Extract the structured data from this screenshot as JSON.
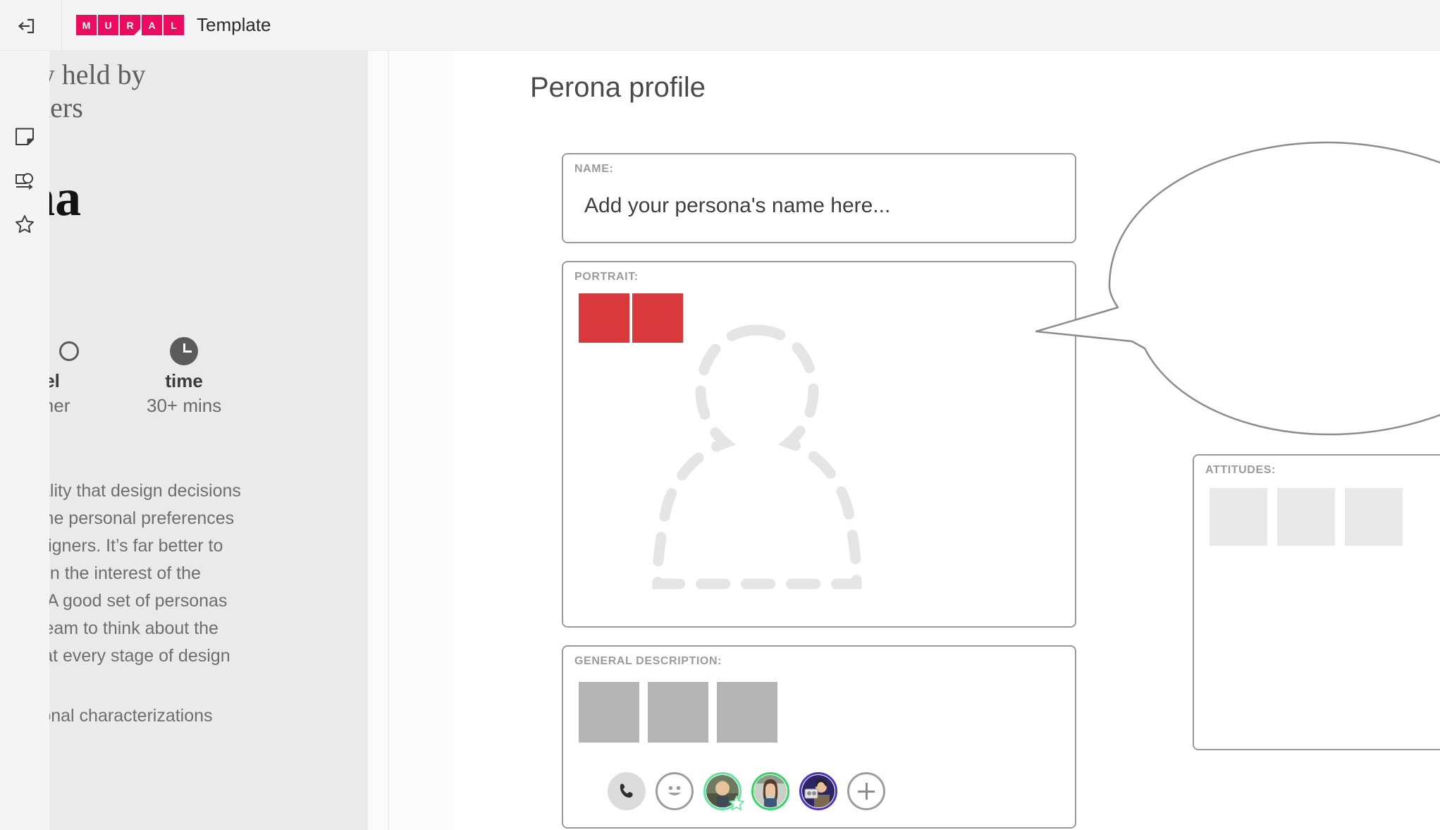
{
  "topbar": {
    "exit_icon": "exit-icon",
    "logo_letters": [
      "M",
      "U",
      "R",
      "A",
      "L"
    ],
    "logo_color": "#ec0b5f",
    "title": "Template"
  },
  "sidebar": {
    "items": [
      {
        "icon": "sticky-note-icon",
        "name": "sticky-note"
      },
      {
        "icon": "shapes-arrow-icon",
        "name": "shapes-and-connectors"
      },
      {
        "icon": "star-icon",
        "name": "favorites"
      }
    ]
  },
  "info_panel": {
    "subhead": "cally held by\nholders",
    "title": "ona\nle",
    "level": {
      "label": "level",
      "value": "eginner",
      "dots_total": 3,
      "dots_filled": 1
    },
    "time": {
      "label": "time",
      "value": "30+ mins",
      "icon": "clock-icon"
    },
    "body": "ue reality that design decisions\nd on the personal preferences\nof designers. It’s far better to\nsions in the interest of the\nrving. A good set of personas\nyour team to think about the\ndeas at every stage of design",
    "body_2": "e fictional characterizations"
  },
  "board": {
    "title": "Perona profile",
    "fields": {
      "name": {
        "label": "NAME:",
        "placeholder": "Add your persona's name here..."
      },
      "portrait": {
        "label": "PORTRAIT:",
        "swatch_color": "#d9383c",
        "swatch_count": 2,
        "placeholder_icon": "person-silhouette-icon"
      },
      "general_description": {
        "label": "GENERAL DESCRIPTION:",
        "swatch_color": "#b4b4b4",
        "swatch_count": 3
      },
      "attitudes": {
        "label": "ATTITUDES:",
        "swatch_color": "#e9e9e9",
        "swatch_count": 3
      }
    },
    "speech_bubble": {
      "name": "speech-bubble-shape",
      "fill": "#ffffff",
      "stroke": "#8c8c8c"
    }
  },
  "collab_toolbar": {
    "phone_icon": "phone-icon",
    "reaction_icon": "smiley-icon",
    "add_label": "+",
    "avatars": [
      {
        "name": "collaborator-1",
        "ring": "#5ce89a",
        "badge": "star-badge-icon"
      },
      {
        "name": "collaborator-2",
        "ring": "#2fd95f",
        "badge": null
      },
      {
        "name": "collaborator-3",
        "ring": "#4b2fd6",
        "badge": null
      }
    ]
  }
}
